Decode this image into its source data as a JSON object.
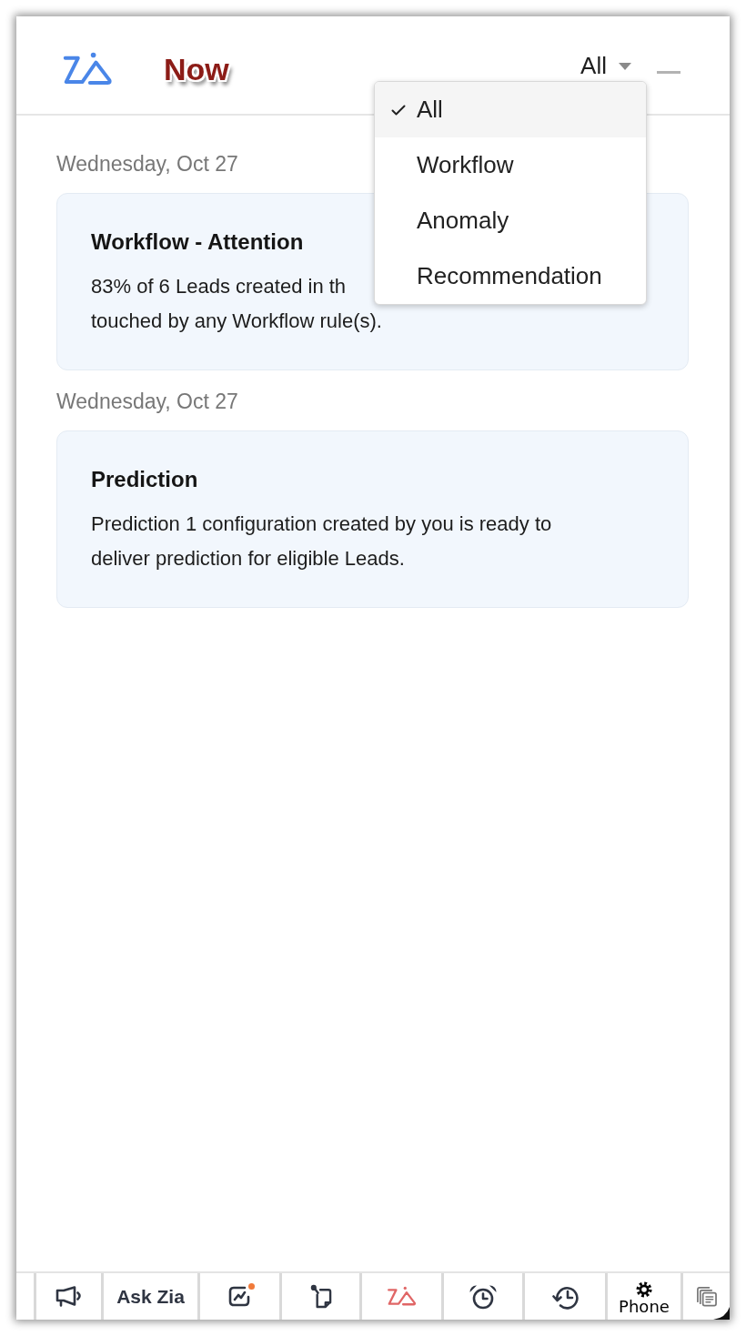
{
  "header": {
    "title": "Now",
    "filter": {
      "value": "All",
      "expanded": true,
      "options": [
        {
          "label": "All",
          "selected": true
        },
        {
          "label": "Workflow",
          "selected": false
        },
        {
          "label": "Anomaly",
          "selected": false
        },
        {
          "label": "Recommendation",
          "selected": false
        }
      ]
    }
  },
  "feed": [
    {
      "date": "Wednesday, Oct 27",
      "title": "Workflow - Attention",
      "lines": [
        "83% of 6 Leads created in th",
        "touched by any Workflow rule(s)."
      ]
    },
    {
      "date": "Wednesday, Oct 27",
      "title": "Prediction",
      "lines": [
        "Prediction 1 configuration created by you is ready to",
        "deliver prediction for eligible Leads."
      ]
    }
  ],
  "bottom_bar": [
    {
      "kind": "icon",
      "selected": false,
      "notification": false
    },
    {
      "kind": "text",
      "label": "Ask Zia",
      "selected": false,
      "notification": false
    },
    {
      "kind": "icon",
      "selected": false,
      "notification": true
    },
    {
      "kind": "icon",
      "selected": false,
      "notification": false
    },
    {
      "kind": "icon",
      "selected": true,
      "notification": false
    },
    {
      "kind": "icon",
      "selected": false,
      "notification": false
    },
    {
      "kind": "icon",
      "selected": false,
      "notification": false
    },
    {
      "kind": "icon_text",
      "label": "Phone",
      "selected": false,
      "notification": false
    },
    {
      "kind": "icon",
      "selected": false,
      "notification": false
    }
  ]
}
